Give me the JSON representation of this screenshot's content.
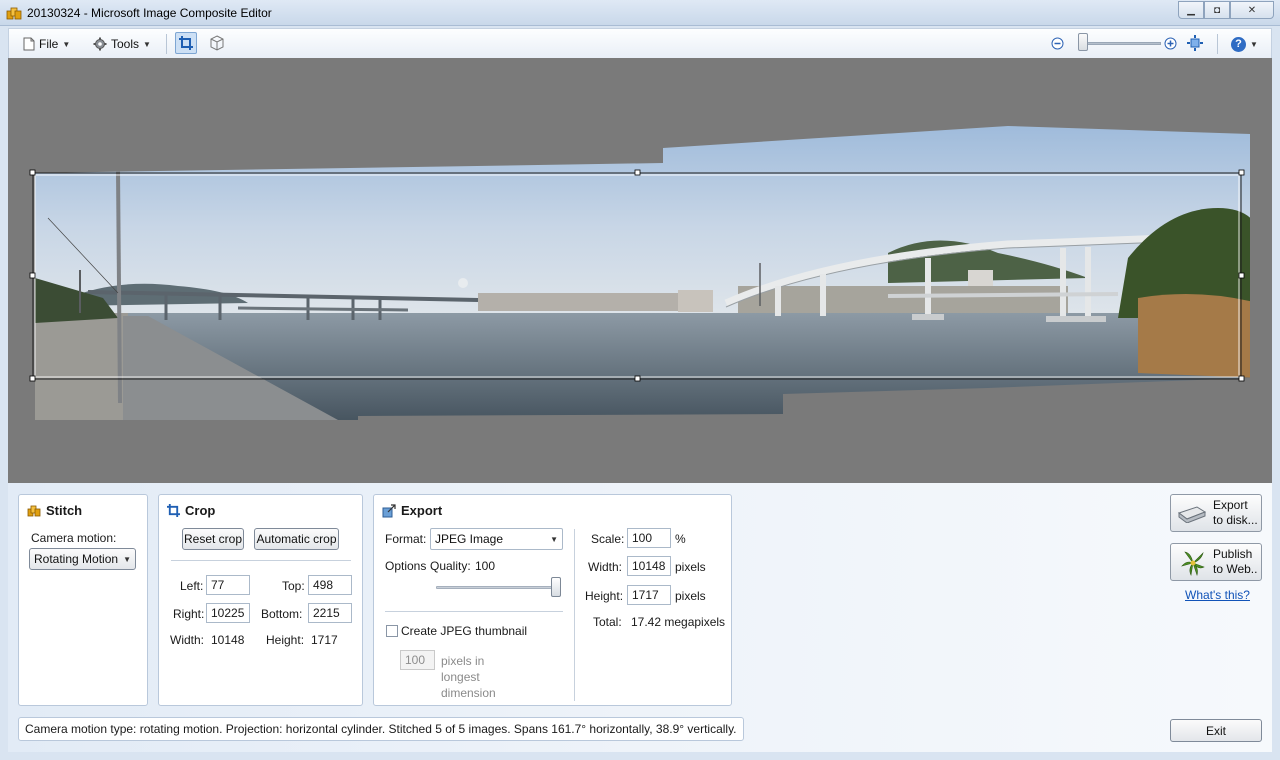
{
  "window": {
    "title": "20130324 - Microsoft Image Composite Editor",
    "minimize_glyph": "▁",
    "maximize_glyph": "◘",
    "close_glyph": "✕"
  },
  "toolbar": {
    "file_label": "File",
    "tools_label": "Tools",
    "help_glyph": "?"
  },
  "stitch": {
    "title": "Stitch",
    "camera_motion_label": "Camera motion:",
    "camera_motion_value": "Rotating Motion"
  },
  "crop": {
    "title": "Crop",
    "reset_label": "Reset crop",
    "auto_label": "Automatic crop",
    "left_label": "Left:",
    "left_value": "77",
    "top_label": "Top:",
    "top_value": "498",
    "right_label": "Right:",
    "right_value": "10225",
    "bottom_label": "Bottom:",
    "bottom_value": "2215",
    "width_label": "Width:",
    "width_value": "10148",
    "height_label": "Height:",
    "height_value": "1717"
  },
  "export": {
    "title": "Export",
    "format_label": "Format:",
    "format_value": "JPEG Image",
    "options_label": "Options",
    "quality_label": "Quality:",
    "quality_value": "100",
    "quality_level": 1.0,
    "thumbnail_label": "Create JPEG thumbnail",
    "thumbnail_checked": false,
    "thumbnail_size": "100",
    "thumbnail_unit_1": "pixels in",
    "thumbnail_unit_2": "longest",
    "thumbnail_unit_3": "dimension",
    "scale_label": "Scale:",
    "scale_value": "100",
    "scale_unit": "%",
    "width_label": "Width:",
    "width_value": "10148",
    "width_unit": "pixels",
    "height_label": "Height:",
    "height_value": "1717",
    "height_unit": "pixels",
    "total_label": "Total:",
    "total_value": "17.42 megapixels"
  },
  "actions": {
    "export_line1": "Export",
    "export_line2": "to disk...",
    "publish_line1": "Publish",
    "publish_line2": "to Web..",
    "whats_this": "What's this?",
    "exit_label": "Exit"
  },
  "status_text": "Camera motion type: rotating motion. Projection: horizontal cylinder. Stitched 5 of 5 images. Spans 161.7° horizontally, 38.9° vertically.",
  "colors": {
    "accent": "#1153b8",
    "canvas_bg": "#7a7a7a"
  }
}
